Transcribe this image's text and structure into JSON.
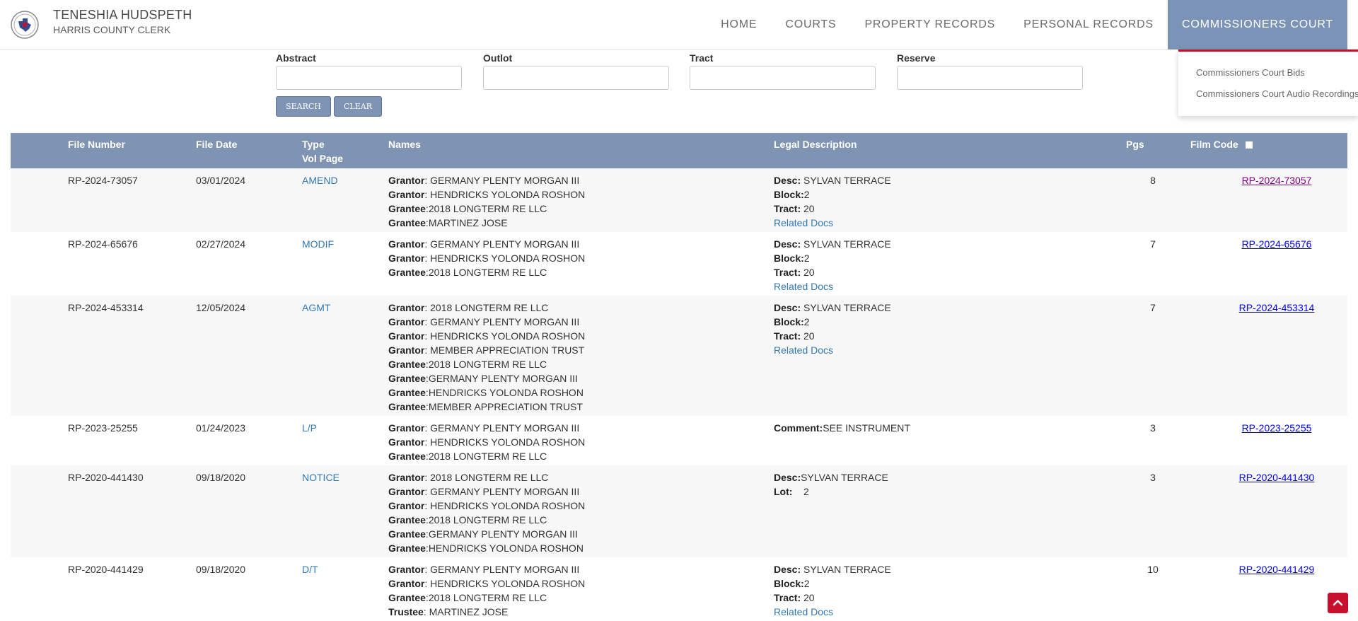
{
  "header": {
    "title": "TENESHIA HUDSPETH",
    "subtitle": "HARRIS COUNTY CLERK",
    "logo_icon": "county-seal-icon"
  },
  "nav": {
    "items": [
      {
        "label": "HOME"
      },
      {
        "label": "COURTS"
      },
      {
        "label": "PROPERTY RECORDS"
      },
      {
        "label": "PERSONAL RECORDS"
      },
      {
        "label": "COMMISSIONERS COURT",
        "active": true
      }
    ],
    "dropdown": [
      "Commissioners Court Bids",
      "Commissioners Court Audio Recordings"
    ]
  },
  "search": {
    "fields": [
      {
        "label": "Abstract",
        "value": ""
      },
      {
        "label": "Outlot",
        "value": ""
      },
      {
        "label": "Tract",
        "value": ""
      },
      {
        "label": "Reserve",
        "value": ""
      }
    ],
    "search_label": "SEARCH",
    "clear_label": "CLEAR"
  },
  "table": {
    "headers": {
      "file_number": "File Number",
      "file_date": "File Date",
      "type": "Type",
      "vol_page": "Vol Page",
      "names": "Names",
      "legal": "Legal Description",
      "pgs": "Pgs",
      "film_code": "Film Code"
    },
    "rows": [
      {
        "file_number": "RP-2024-73057",
        "file_date": "03/01/2024",
        "type": "AMEND",
        "names": [
          {
            "role": "Grantor",
            "sep": ": ",
            "name": "GERMANY PLENTY MORGAN III"
          },
          {
            "role": "Grantor",
            "sep": ": ",
            "name": "HENDRICKS YOLONDA ROSHON"
          },
          {
            "role": "Grantee",
            "sep": ":",
            "name": "2018 LONGTERM RE LLC"
          },
          {
            "role": "Grantee",
            "sep": ":",
            "name": "MARTINEZ JOSE"
          }
        ],
        "legal": [
          {
            "label": "Desc:",
            "value": " SYLVAN TERRACE"
          },
          {
            "label": "Block:",
            "value": "2"
          },
          {
            "label": "Tract:",
            "value": " 20"
          }
        ],
        "related": "Related Docs",
        "pgs": "8",
        "film_code": "RP-2024-73057",
        "visited": true
      },
      {
        "file_number": "RP-2024-65676",
        "file_date": "02/27/2024",
        "type": "MODIF",
        "names": [
          {
            "role": "Grantor",
            "sep": ": ",
            "name": "GERMANY PLENTY MORGAN III"
          },
          {
            "role": "Grantor",
            "sep": ": ",
            "name": "HENDRICKS YOLONDA ROSHON"
          },
          {
            "role": "Grantee",
            "sep": ":",
            "name": "2018 LONGTERM RE LLC"
          }
        ],
        "legal": [
          {
            "label": "Desc:",
            "value": " SYLVAN TERRACE"
          },
          {
            "label": "Block:",
            "value": "2"
          },
          {
            "label": "Tract:",
            "value": " 20"
          }
        ],
        "related": "Related Docs",
        "pgs": "7",
        "film_code": "RP-2024-65676",
        "visited": false
      },
      {
        "file_number": "RP-2024-453314",
        "file_date": "12/05/2024",
        "type": "AGMT",
        "names": [
          {
            "role": "Grantor",
            "sep": ": ",
            "name": "2018 LONGTERM RE LLC"
          },
          {
            "role": "Grantor",
            "sep": ": ",
            "name": "GERMANY PLENTY MORGAN III"
          },
          {
            "role": "Grantor",
            "sep": ": ",
            "name": "HENDRICKS YOLONDA ROSHON"
          },
          {
            "role": "Grantor",
            "sep": ": ",
            "name": "MEMBER APPRECIATION TRUST"
          },
          {
            "role": "Grantee",
            "sep": ":",
            "name": "2018 LONGTERM RE LLC"
          },
          {
            "role": "Grantee",
            "sep": ":",
            "name": "GERMANY PLENTY MORGAN III"
          },
          {
            "role": "Grantee",
            "sep": ":",
            "name": "HENDRICKS YOLONDA ROSHON"
          },
          {
            "role": "Grantee",
            "sep": ":",
            "name": "MEMBER APPRECIATION TRUST"
          }
        ],
        "legal": [
          {
            "label": "Desc:",
            "value": " SYLVAN TERRACE"
          },
          {
            "label": "Block:",
            "value": "2"
          },
          {
            "label": "Tract:",
            "value": " 20"
          }
        ],
        "related": "Related Docs",
        "pgs": "7",
        "film_code": "RP-2024-453314",
        "visited": false
      },
      {
        "file_number": "RP-2023-25255",
        "file_date": "01/24/2023",
        "type": "L/P",
        "names": [
          {
            "role": "Grantor",
            "sep": ": ",
            "name": "GERMANY PLENTY MORGAN III"
          },
          {
            "role": "Grantor",
            "sep": ": ",
            "name": "HENDRICKS YOLONDA ROSHON"
          },
          {
            "role": "Grantee",
            "sep": ":",
            "name": "2018 LONGTERM RE LLC"
          }
        ],
        "legal": [
          {
            "label": "Comment:",
            "value": "SEE INSTRUMENT"
          }
        ],
        "related": "",
        "pgs": "3",
        "film_code": "RP-2023-25255",
        "visited": false
      },
      {
        "file_number": "RP-2020-441430",
        "file_date": "09/18/2020",
        "type": "NOTICE",
        "names": [
          {
            "role": "Grantor",
            "sep": ": ",
            "name": "2018 LONGTERM RE LLC"
          },
          {
            "role": "Grantor",
            "sep": ": ",
            "name": "GERMANY PLENTY MORGAN III"
          },
          {
            "role": "Grantor",
            "sep": ": ",
            "name": "HENDRICKS YOLONDA ROSHON"
          },
          {
            "role": "Grantee",
            "sep": ":",
            "name": "2018 LONGTERM RE LLC"
          },
          {
            "role": "Grantee",
            "sep": ":",
            "name": "GERMANY PLENTY MORGAN III"
          },
          {
            "role": "Grantee",
            "sep": ":",
            "name": "HENDRICKS YOLONDA ROSHON"
          }
        ],
        "legal": [
          {
            "label": "Desc:",
            "value": "SYLVAN TERRACE"
          },
          {
            "label": "Lot:",
            "value": "    2"
          }
        ],
        "related": "",
        "pgs": "3",
        "film_code": "RP-2020-441430",
        "visited": false
      },
      {
        "file_number": "RP-2020-441429",
        "file_date": "09/18/2020",
        "type": "D/T",
        "names": [
          {
            "role": "Grantor",
            "sep": ": ",
            "name": "GERMANY PLENTY MORGAN III"
          },
          {
            "role": "Grantor",
            "sep": ": ",
            "name": "HENDRICKS YOLONDA ROSHON"
          },
          {
            "role": "Grantee",
            "sep": ":",
            "name": "2018 LONGTERM RE LLC"
          },
          {
            "role": "Trustee",
            "sep": ": ",
            "name": "MARTINEZ JOSE"
          }
        ],
        "legal": [
          {
            "label": "Desc:",
            "value": " SYLVAN TERRACE"
          },
          {
            "label": "Block:",
            "value": "2"
          },
          {
            "label": "Tract:",
            "value": " 20"
          }
        ],
        "related": "Related Docs",
        "pgs": "10",
        "film_code": "RP-2020-441429",
        "visited": false
      }
    ]
  },
  "scroll_top_icon": "chevron-up-icon",
  "colors": {
    "header_bar": "#7f93b2",
    "accent_red": "#c8102e",
    "link_blue": "#3379b5"
  }
}
